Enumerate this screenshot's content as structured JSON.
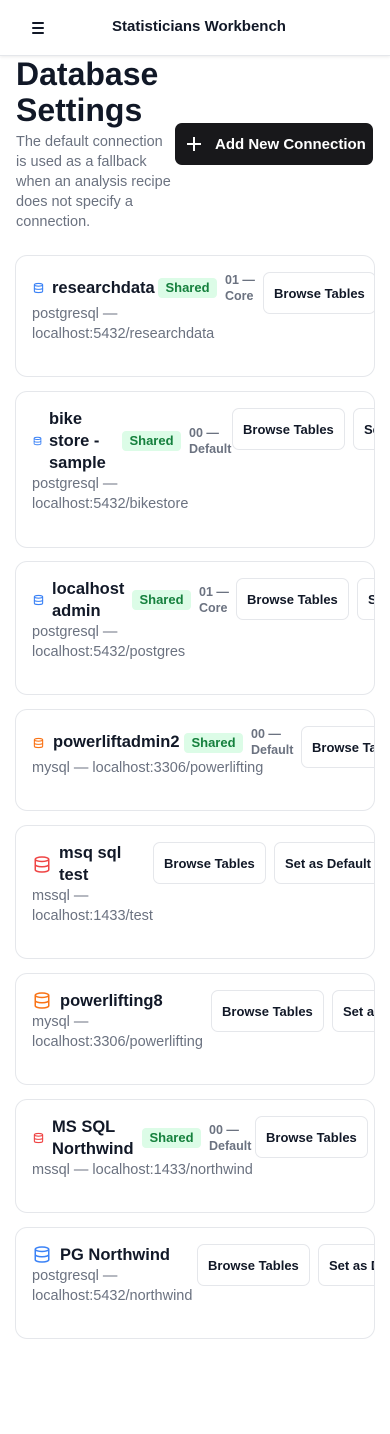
{
  "app": {
    "title": "Statisticians Workbench"
  },
  "page": {
    "title": "Database Settings",
    "description": "The default connection is used as a fallback when an analysis recipe does not specify a connection.",
    "add_button": "Add New Connection"
  },
  "colors": {
    "postgres_icon": "#3b82f6",
    "mysql_icon": "#f97316",
    "mssql_icon": "#ef4444",
    "badge_bg": "#dcfce7",
    "badge_text": "#15803d"
  },
  "connections": [
    {
      "name": "researchdata",
      "badge": "Shared",
      "meta": "01 — Core",
      "address": "postgresql — localhost:5432/researchdata",
      "browse": "Browse Tables",
      "icon": "database-icon"
    },
    {
      "name": "bike store - sample",
      "badge": "Shared",
      "meta": "00 — Default",
      "address": "postgresql — localhost:5432/bikestore",
      "browse": "Browse Tables",
      "set_default": "Set as Default",
      "icon": "database-icon"
    },
    {
      "name": "localhost admin",
      "badge": "Shared",
      "meta": "01 — Core",
      "address": "postgresql — localhost:5432/postgres",
      "browse": "Browse Tables",
      "set_default": "Set as Default",
      "icon": "database-icon"
    },
    {
      "name": "powerliftadmin2",
      "badge": "Shared",
      "meta": "00 — Default",
      "address": "mysql — localhost:3306/powerlifting",
      "browse": "Browse Tables",
      "icon": "database-icon"
    },
    {
      "name": "msq sql test",
      "address": "mssql — localhost:1433/test",
      "browse": "Browse Tables",
      "set_default": "Set as Default",
      "icon": "database-icon"
    },
    {
      "name": "powerlifting8",
      "address": "mysql — localhost:3306/powerlifting",
      "browse": "Browse Tables",
      "set_default": "Set as Default",
      "icon": "database-icon"
    },
    {
      "name": "MS SQL Northwind",
      "badge": "Shared",
      "meta": "00 — Default",
      "address": "mssql — localhost:1433/northwind",
      "browse": "Browse Tables",
      "icon": "database-icon"
    },
    {
      "name": "PG Northwind",
      "address": "postgresql — localhost:5432/northwind",
      "browse": "Browse Tables",
      "set_default": "Set as Default",
      "icon": "database-icon"
    }
  ]
}
